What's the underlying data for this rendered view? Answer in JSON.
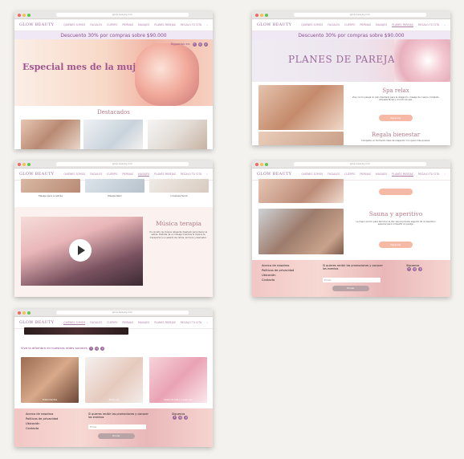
{
  "brand": "GLOW BEAUTY",
  "url": "glow-beauty.com",
  "nav_items": [
    "QUIÉNES SOMOS",
    "FACIALES",
    "CUERPO",
    "PIERNAS",
    "MASAJES",
    "PLANES PAREJAS",
    "REGALO TU CITA"
  ],
  "promo_banner": "Descuento 30% por compras sobre $90.000",
  "window1": {
    "hero_title": "Especial mes de la mujer",
    "social_label": "Síguenos en:",
    "featured_title": "Destacados"
  },
  "window2": {
    "hero_title": "PLANES DE PAREJAS",
    "plan1_title": "Spa relax",
    "plan1_text": "Vive con tu pareja un plan diseñado para la relajación: masaje de cuerpo completo, limpieza facial y circuito de spa.",
    "plan1_button": "Reservar",
    "plan2_title": "Regala bienestar",
    "plan2_text": "Comparte un momento ideal de relajación con quien más quieres."
  },
  "window3": {
    "captions": [
      "Masaje para el estrés",
      "Masaje Reiki",
      "Limpieza facial"
    ],
    "music_title": "Música terapia",
    "music_text": "Un circuito de música relajante diseñado para liberar el estrés. Disfruta de un masaje mientras la música te transporta a un estado de calma, armonía y bienestar."
  },
  "window4": {
    "plan3_title": "Sauna y aperitivo",
    "plan3_text": "La mejor opción para terminar el día: sauna privado seguido de un aperitivo especial para compartir en pareja.",
    "plan3_button": "Reservar"
  },
  "window5": {
    "social_label": "Vive la alfombra en nuestras redes sociales",
    "captions": [
      "Tratamientos",
      "Manicure",
      "Sales de baño y esencias"
    ]
  },
  "footer": {
    "links": [
      "Acerca de nosotros",
      "Políticas de privacidad",
      "Ubicación",
      "Contacto"
    ],
    "newsletter_text": "Si quieres recibir las promociones y conocer los eventos",
    "email_placeholder": "Email",
    "submit_label": "Enviar",
    "follow_label": "Síguenos"
  },
  "colors": {
    "accent": "#9b6a9a",
    "title": "#b47a86",
    "button": "#f6b9a6",
    "banner_bg": "#f1e8f6"
  }
}
